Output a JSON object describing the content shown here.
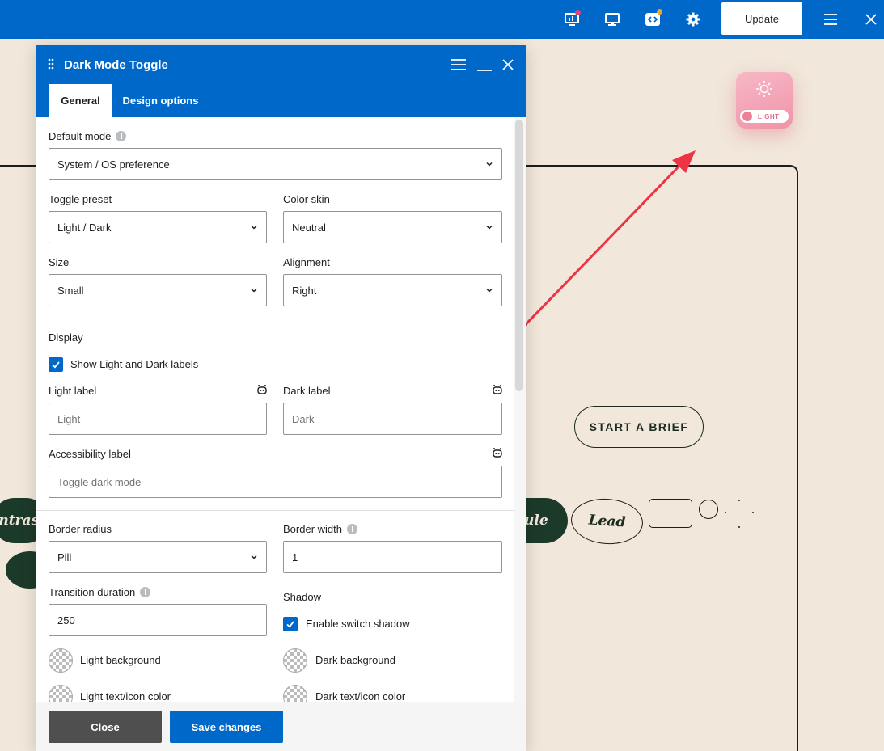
{
  "toolbar": {
    "update_label": "Update",
    "icons": [
      "stats-icon",
      "desktop-preview-icon",
      "code-icon",
      "settings-gear-icon",
      "menu-icon",
      "close-icon"
    ],
    "accent": "#0068c9"
  },
  "canvas": {
    "toggle_preview_text": "LIGHT",
    "brief_button": "START A BRIEF",
    "pill_left_text": "ntrast",
    "pill_right_text": "ule",
    "lead_text": "Lead",
    "arrow_color": "#ee3344"
  },
  "dialog": {
    "title": "Dark Mode Toggle",
    "tabs": [
      {
        "label": "General",
        "active": true
      },
      {
        "label": "Design options",
        "active": false
      }
    ],
    "default_mode": {
      "label": "Default mode",
      "value": "System / OS preference"
    },
    "toggle_preset": {
      "label": "Toggle preset",
      "value": "Light / Dark"
    },
    "color_skin": {
      "label": "Color skin",
      "value": "Neutral"
    },
    "size": {
      "label": "Size",
      "value": "Small"
    },
    "alignment": {
      "label": "Alignment",
      "value": "Right"
    },
    "display": {
      "heading": "Display",
      "show_labels": {
        "label": "Show Light and Dark labels",
        "checked": true
      }
    },
    "light_label": {
      "label": "Light label",
      "placeholder": "Light"
    },
    "dark_label": {
      "label": "Dark label",
      "placeholder": "Dark"
    },
    "accessibility_label": {
      "label": "Accessibility label",
      "placeholder": "Toggle dark mode"
    },
    "border_radius": {
      "label": "Border radius",
      "value": "Pill"
    },
    "border_width": {
      "label": "Border width",
      "value": "1"
    },
    "transition_duration": {
      "label": "Transition duration",
      "value": "250"
    },
    "shadow": {
      "heading": "Shadow",
      "enable": {
        "label": "Enable switch shadow",
        "checked": true
      }
    },
    "colors": {
      "light_background": "Light background",
      "dark_background": "Dark background",
      "light_text_icon": "Light text/icon color",
      "dark_text_icon": "Dark text/icon color"
    },
    "footer": {
      "close_label": "Close",
      "save_label": "Save changes"
    }
  }
}
